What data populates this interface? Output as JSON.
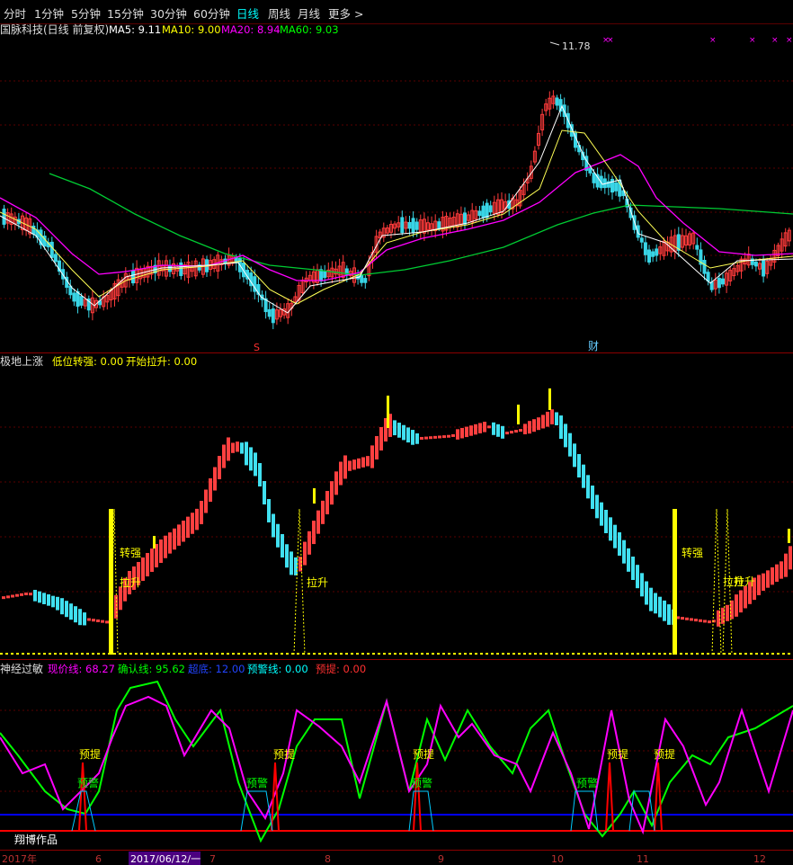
{
  "toolbar": {
    "periods": [
      "分时",
      "1分钟",
      "5分钟",
      "15分钟",
      "30分钟",
      "60分钟",
      "日线",
      "周线",
      "月线",
      "更多 >"
    ],
    "active": "日线"
  },
  "main_panel": {
    "title": "国脉科技(日线 前复权)",
    "ma5": "MA5: 9.11",
    "ma10": "MA10: 9.00",
    "ma20": "MA20: 8.94",
    "ma60": "MA60: 9.03",
    "peak_label": "11.78",
    "event_s": "S",
    "event_cai": "财",
    "marks": [
      "×",
      "×",
      "×",
      "×",
      "×",
      "×"
    ]
  },
  "mid_panel": {
    "title": "极地上涨",
    "low_strong": "低位转强: 0.00",
    "start_rise": "开始拉升: 0.00",
    "labels": [
      "转强",
      "拉升",
      "拉升",
      "转强",
      "拉升",
      "拉升"
    ]
  },
  "bottom_panel": {
    "title": "神经过敏",
    "price_line": "现价线: 68.27",
    "confirm_line": "确认线: 95.62",
    "bottom_line": "超底: 12.00",
    "warn_line": "预警线: 0.00",
    "pre_line": "预提: 0.00",
    "labels": [
      "预提",
      "预警",
      "预提",
      "预警",
      "预提",
      "预警",
      "预提",
      "预警",
      "预提"
    ],
    "credit": "翔博作品"
  },
  "date_axis": {
    "labels": [
      "2017年",
      "6",
      "2017/06/12/一",
      "7",
      "8",
      "9",
      "10",
      "11",
      "12"
    ]
  },
  "chart_data": [
    {
      "type": "candlestick",
      "title": "国脉科技(日线 前复权)",
      "series": [
        {
          "name": "MA5",
          "last": 9.11,
          "color": "#ffffff"
        },
        {
          "name": "MA10",
          "last": 9.0,
          "color": "#ffff00"
        },
        {
          "name": "MA20",
          "last": 8.94,
          "color": "#ff00ff"
        },
        {
          "name": "MA60",
          "last": 9.03,
          "color": "#00ff00"
        }
      ],
      "annotations": [
        {
          "text": "11.78",
          "kind": "peak high"
        }
      ]
    },
    {
      "type": "bar",
      "title": "极地上涨",
      "series": [
        {
          "name": "低位转强",
          "last": 0.0
        },
        {
          "name": "开始拉升",
          "last": 0.0
        }
      ]
    },
    {
      "type": "line",
      "title": "神经过敏",
      "ylim": [
        0,
        100
      ],
      "series": [
        {
          "name": "现价线",
          "last": 68.27,
          "color": "#ff00ff"
        },
        {
          "name": "确认线",
          "last": 95.62,
          "color": "#00ff00"
        },
        {
          "name": "超底",
          "last": 12.0,
          "color": "#0000ff"
        },
        {
          "name": "预警线",
          "last": 0.0,
          "color": "#00ffff"
        },
        {
          "name": "预提",
          "last": 0.0,
          "color": "#ff0000"
        }
      ]
    }
  ]
}
